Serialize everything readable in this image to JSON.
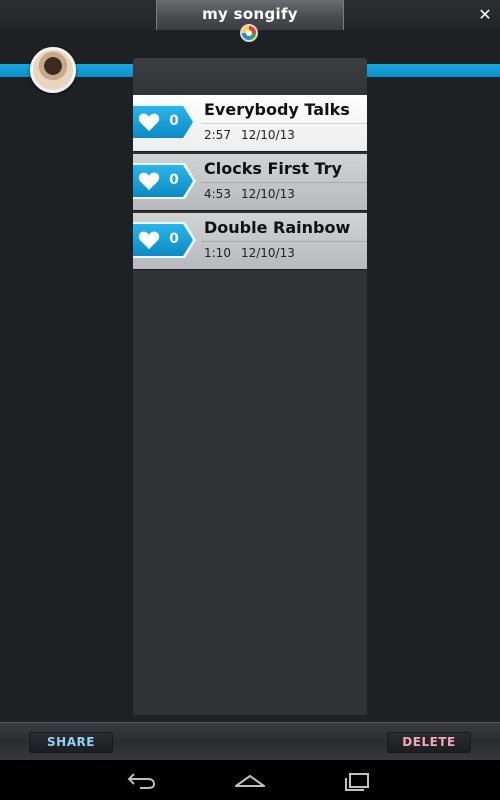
{
  "header": {
    "title": "my songify",
    "logo_icon": "songify-logo-icon",
    "close_icon": "close-icon",
    "close_glyph": "✕"
  },
  "profile": {
    "avatar_icon": "profile-avatar"
  },
  "colors": {
    "accent_blue": "#139ad6",
    "share_text": "#8fd3f2",
    "delete_text": "#f0a8b8",
    "selected_row": "#ffffff",
    "row": "#c4c5c8"
  },
  "songs": [
    {
      "title": "Everybody Talks",
      "duration": "2:57",
      "date": "12/10/13",
      "likes": "0",
      "selected": true
    },
    {
      "title": "Clocks First Try",
      "duration": "4:53",
      "date": "12/10/13",
      "likes": "0",
      "selected": false
    },
    {
      "title": "Double Rainbow",
      "duration": "1:10",
      "date": "12/10/13",
      "likes": "0",
      "selected": false
    }
  ],
  "actions": {
    "share_label": "SHARE",
    "delete_label": "DELETE"
  },
  "system_nav": {
    "back_icon": "back-icon",
    "home_icon": "home-icon",
    "recents_icon": "recent-apps-icon"
  }
}
